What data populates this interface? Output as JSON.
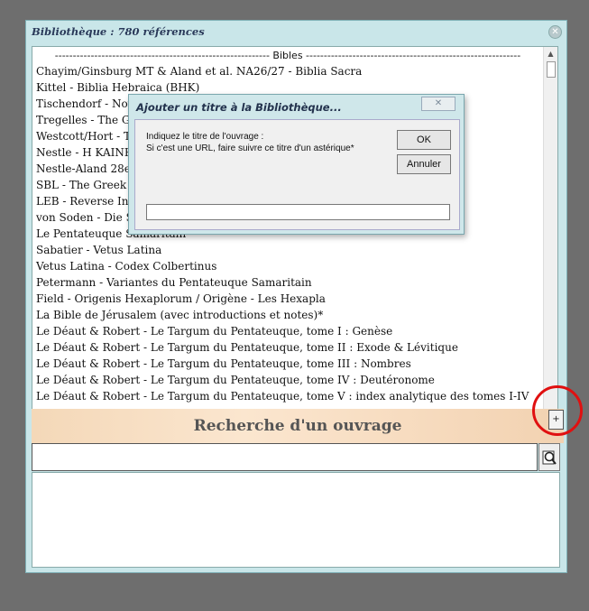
{
  "window": {
    "title": "Bibliothèque : 780 références",
    "close_glyph": "✕"
  },
  "list": {
    "separator": "------------------------------------------------------------ Bibles ------------------------------------------------------------",
    "items": [
      "Chayim/Ginsburg MT & Aland et al. NA26/27 - Biblia Sacra",
      "Kittel - Biblia Hebraica (BHK)",
      "Tischendorf - Novu",
      "Tregelles - The Gre",
      "Westcott/Hort - Th",
      "Nestle - H KAINH",
      "Nestle-Aland 28e e",
      "SBL - The Greek N",
      "LEB - Reverse Inte",
      "von Soden - Die Sc",
      "Le Pentateuque Samaritain",
      "Sabatier - Vetus Latina",
      "Vetus Latina - Codex Colbertinus",
      "Petermann - Variantes du Pentateuque Samaritain",
      "Field - Origenis Hexaplorum / Origène - Les Hexapla",
      "La Bible de Jérusalem (avec introductions et notes)*",
      "Le Déaut & Robert - Le Targum du Pentateuque, tome I : Genèse",
      "Le Déaut & Robert - Le Targum du Pentateuque, tome II : Exode & Lévitique",
      "Le Déaut & Robert - Le Targum du Pentateuque, tome III : Nombres",
      "Le Déaut & Robert - Le Targum du Pentateuque, tome IV : Deutéronome",
      "Le Déaut & Robert - Le Targum du Pentateuque, tome V : index analytique des tomes I-IV"
    ]
  },
  "search": {
    "title": "Recherche d'un ouvrage",
    "add_label": "+",
    "value": ""
  },
  "dialog": {
    "title": "Ajouter un titre à la Bibliothèque...",
    "close_glyph": "✕",
    "prompt_line1": "Indiquez le titre de l'ouvrage :",
    "prompt_line2": "Si c'est une URL, faire suivre ce titre d'un astérique*",
    "ok_label": "OK",
    "cancel_label": "Annuler",
    "input_value": ""
  },
  "colors": {
    "annotation_ring": "#e01010",
    "window_bg": "#c9e6e9"
  }
}
